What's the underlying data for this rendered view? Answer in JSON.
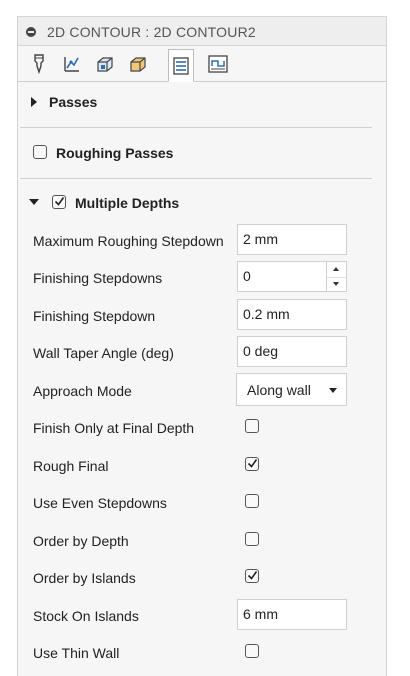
{
  "window": {
    "title": "2D CONTOUR : 2D CONTOUR2"
  },
  "tabs": [
    {
      "icon": "tool-icon",
      "active": false
    },
    {
      "icon": "geometry-icon",
      "active": false
    },
    {
      "icon": "heights-icon",
      "active": false
    },
    {
      "icon": "stock-icon",
      "active": false
    },
    {
      "icon": "passes-icon",
      "active": true
    },
    {
      "icon": "linking-icon",
      "active": false
    }
  ],
  "sections": {
    "passes": {
      "title": "Passes",
      "expanded": false
    },
    "roughing_passes": {
      "title": "Roughing Passes",
      "checked": false
    },
    "multiple_depths": {
      "title": "Multiple Depths",
      "checked": true,
      "expanded": true
    }
  },
  "fields": {
    "max_roughing_stepdown": {
      "label": "Maximum Roughing Stepdown",
      "value": "2 mm"
    },
    "finishing_stepdowns": {
      "label": "Finishing Stepdowns",
      "value": "0"
    },
    "finishing_stepdown": {
      "label": "Finishing Stepdown",
      "value": "0.2 mm"
    },
    "wall_taper_angle": {
      "label": "Wall Taper Angle (deg)",
      "value": "0 deg"
    },
    "approach_mode": {
      "label": "Approach Mode",
      "value": "Along wall"
    },
    "finish_only_final_depth": {
      "label": "Finish Only at Final Depth",
      "checked": false
    },
    "rough_final": {
      "label": "Rough Final",
      "checked": true
    },
    "use_even_stepdowns": {
      "label": "Use Even Stepdowns",
      "checked": false
    },
    "order_by_depth": {
      "label": "Order by Depth",
      "checked": false
    },
    "order_by_islands": {
      "label": "Order by Islands",
      "checked": true
    },
    "stock_on_islands": {
      "label": "Stock On Islands",
      "value": "6 mm"
    },
    "use_thin_wall": {
      "label": "Use Thin Wall",
      "checked": false
    }
  },
  "colors": {
    "accent": "#2b6cb0",
    "panel_bg": "#f6f6f6",
    "border": "#cfcfcf"
  }
}
